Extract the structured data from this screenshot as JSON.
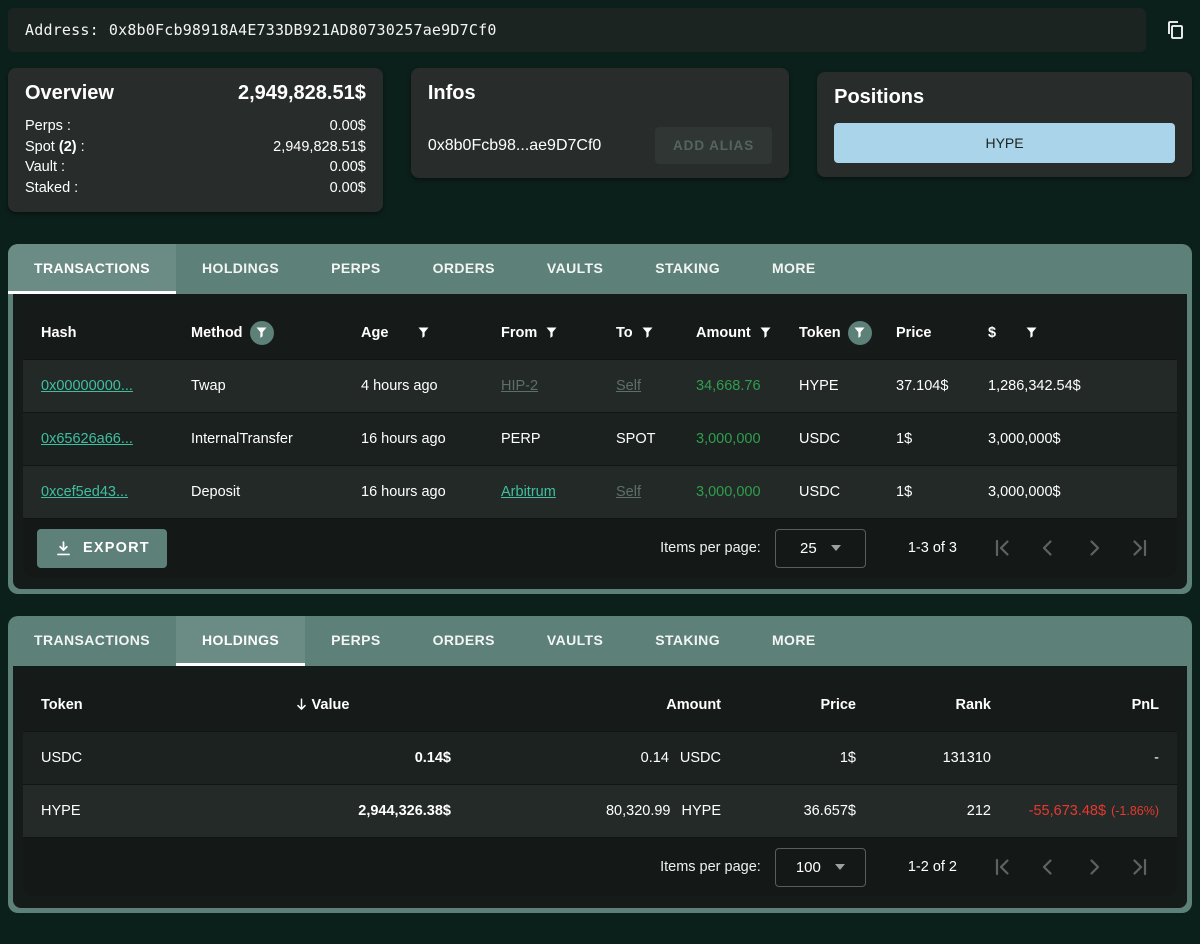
{
  "colors": {
    "page_bg": "#0c201b",
    "accent_sage": "#5d8078",
    "link_teal": "#40bfa0",
    "muted_link": "#5e6e68",
    "amount_green": "#2f9e4f",
    "pnl_red": "#e8382f",
    "positions_blue": "#a9d4e9"
  },
  "address_bar": {
    "label": "Address:",
    "value": "0x8b0Fcb98918A4E733DB921AD80730257ae9D7Cf0"
  },
  "overview": {
    "title": "Overview",
    "total": "2,949,828.51$",
    "rows": [
      {
        "label": "Perps :",
        "value": "0.00$"
      },
      {
        "label_prefix": "Spot ",
        "label_bold": "(2)",
        "label_suffix": " :",
        "value": "2,949,828.51$"
      },
      {
        "label": "Vault :",
        "value": "0.00$"
      },
      {
        "label": "Staked :",
        "value": "0.00$"
      }
    ]
  },
  "infos": {
    "title": "Infos",
    "address_short": "0x8b0Fcb98...ae9D7Cf0",
    "add_alias_label": "ADD ALIAS"
  },
  "positions": {
    "title": "Positions",
    "items": [
      "HYPE"
    ]
  },
  "tabs": {
    "items": [
      "TRANSACTIONS",
      "HOLDINGS",
      "PERPS",
      "ORDERS",
      "VAULTS",
      "STAKING",
      "MORE"
    ]
  },
  "transactions": {
    "active_tab": "TRANSACTIONS",
    "columns": [
      {
        "label": "Hash",
        "filter": "none"
      },
      {
        "label": "Method",
        "filter": "active-circle"
      },
      {
        "label": "Age",
        "filter": "plain"
      },
      {
        "label": "From",
        "filter": "plain"
      },
      {
        "label": "To",
        "filter": "plain"
      },
      {
        "label": "Amount",
        "filter": "plain"
      },
      {
        "label": "Token",
        "filter": "active-circle"
      },
      {
        "label": "Price",
        "filter": "none"
      },
      {
        "label": "$",
        "filter": "plain"
      }
    ],
    "rows": [
      {
        "hash": "0x00000000...",
        "method": "Twap",
        "age": "4 hours ago",
        "from": "HIP-2",
        "to": "Self",
        "amount": "34,668.76",
        "token": "HYPE",
        "price": "37.104$",
        "usd": "1,286,342.54$"
      },
      {
        "hash": "0x65626a66...",
        "method": "InternalTransfer",
        "age": "16 hours ago",
        "from": "PERP",
        "to": "SPOT",
        "amount": "3,000,000",
        "token": "USDC",
        "price": "1$",
        "usd": "3,000,000$"
      },
      {
        "hash": "0xcef5ed43...",
        "method": "Deposit",
        "age": "16 hours ago",
        "from": "Arbitrum",
        "to": "Self",
        "amount": "3,000,000",
        "token": "USDC",
        "price": "1$",
        "usd": "3,000,000$"
      }
    ],
    "footer": {
      "export_label": "EXPORT",
      "items_per_page_label": "Items per page:",
      "page_size": "25",
      "range_label": "1-3 of 3"
    }
  },
  "holdings": {
    "active_tab": "HOLDINGS",
    "columns": [
      {
        "label": "Token"
      },
      {
        "label": "Value",
        "sorted": "desc"
      },
      {
        "label": "Amount"
      },
      {
        "label": "Price"
      },
      {
        "label": "Rank"
      },
      {
        "label": "PnL"
      }
    ],
    "rows": [
      {
        "token": "USDC",
        "value": "0.14$",
        "amount_value": "0.14",
        "amount_symbol": "USDC",
        "price": "1$",
        "rank": "131310",
        "pnl": "-",
        "pnl_pct": ""
      },
      {
        "token": "HYPE",
        "value": "2,944,326.38$",
        "amount_value": "80,320.99",
        "amount_symbol": "HYPE",
        "price": "36.657$",
        "rank": "212",
        "pnl": "-55,673.48$",
        "pnl_pct": "(-1.86%)"
      }
    ],
    "footer": {
      "items_per_page_label": "Items per page:",
      "page_size": "100",
      "range_label": "1-2 of 2"
    }
  }
}
